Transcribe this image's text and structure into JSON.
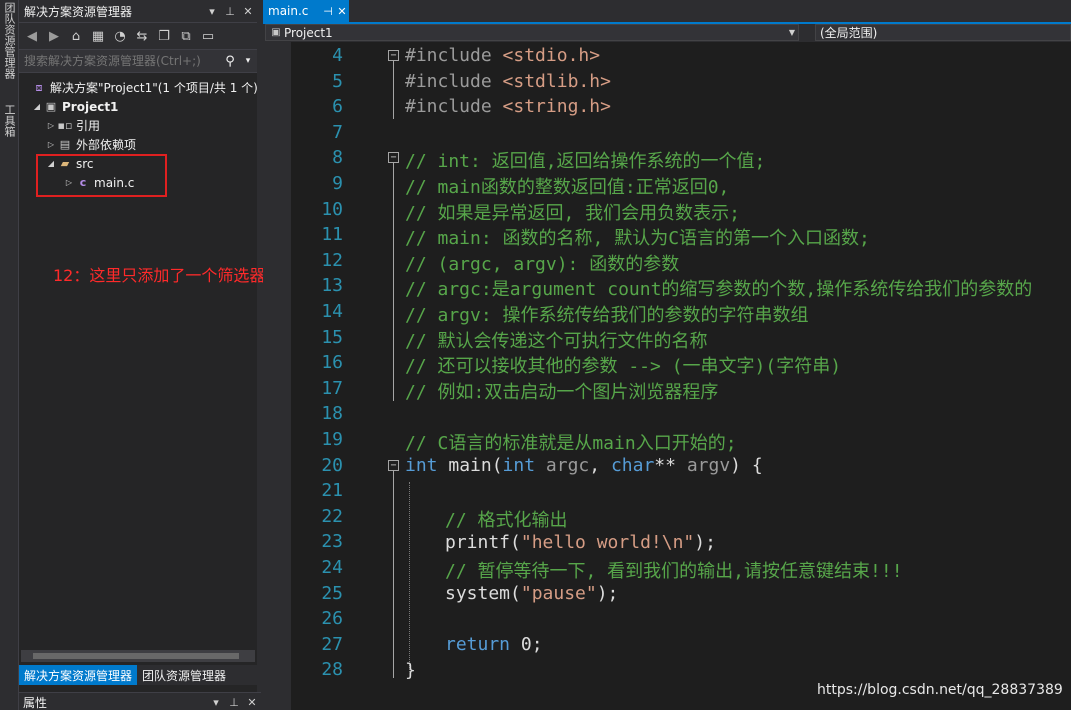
{
  "left_strip": {
    "tab1": "团队资源管理器",
    "tab2": "工具箱"
  },
  "solution_explorer": {
    "title": "解决方案资源管理器",
    "search_placeholder": "搜索解决方案资源管理器(Ctrl+;)",
    "tree": {
      "solution": "解决方案\"Project1\"(1 个项目/共 1 个)",
      "project": "Project1",
      "references": "引用",
      "external_deps": "外部依赖项",
      "src_filter": "src",
      "main_file": "main.c"
    },
    "tabs": [
      "解决方案资源管理器",
      "团队资源管理器"
    ],
    "properties_title": "属性"
  },
  "annotation": "12：这里只添加了一个筛选器",
  "editor": {
    "tab_label": "main.c",
    "nav_project": "Project1",
    "nav_scope": "(全局范围)",
    "lines": [
      {
        "n": "4"
      },
      {
        "n": "5"
      },
      {
        "n": "6"
      },
      {
        "n": "7"
      },
      {
        "n": "8"
      },
      {
        "n": "9"
      },
      {
        "n": "10"
      },
      {
        "n": "11"
      },
      {
        "n": "12"
      },
      {
        "n": "13"
      },
      {
        "n": "14"
      },
      {
        "n": "15"
      },
      {
        "n": "16"
      },
      {
        "n": "17"
      },
      {
        "n": "18"
      },
      {
        "n": "19"
      },
      {
        "n": "20"
      },
      {
        "n": "21"
      },
      {
        "n": "22"
      },
      {
        "n": "23"
      },
      {
        "n": "24"
      },
      {
        "n": "25"
      },
      {
        "n": "26"
      },
      {
        "n": "27"
      },
      {
        "n": "28"
      }
    ],
    "code": {
      "l4_pp": "#include ",
      "l4_hdr": "<stdio.h>",
      "l5_pp": "#include ",
      "l5_hdr": "<stdlib.h>",
      "l6_pp": "#include ",
      "l6_hdr": "<string.h>",
      "l8": "// int: 返回值,返回给操作系统的一个值;",
      "l9": "// main函数的整数返回值:正常返回0,",
      "l10": "// 如果是异常返回, 我们会用负数表示;",
      "l11": "// main: 函数的名称, 默认为C语言的第一个入口函数;",
      "l12": "// (argc, argv): 函数的参数",
      "l13": "// argc:是argument count的缩写参数的个数,操作系统传给我们的参数的",
      "l14": "// argv: 操作系统传给我们的参数的字符串数组",
      "l15": "// 默认会传递这个可执行文件的名称",
      "l16": "// 还可以接收其他的参数 --> (一串文字)(字符串)",
      "l17": "// 例如:双击启动一个图片浏览器程序",
      "l19": "// C语言的标准就是从main入口开始的;",
      "l20_kw1": "int",
      "l20_fn": " main(",
      "l20_kw2": "int",
      "l20_p1": " argc",
      "l20_sep": ", ",
      "l20_kw3": "char",
      "l20_ptr": "**",
      "l20_p2": " argv",
      "l20_end": ") {",
      "l22": "// 格式化输出",
      "l23_fn": "printf(",
      "l23_str": "\"hello world!\\n\"",
      "l23_end": ");",
      "l24": "// 暂停等待一下, 看到我们的输出,请按任意键结束!!!",
      "l25_fn": "system(",
      "l25_str": "\"pause\"",
      "l25_end": ");",
      "l27_kw": "return",
      "l27_end": " 0;",
      "l28": "}"
    }
  },
  "watermark": "https://blog.csdn.net/qq_28837389"
}
